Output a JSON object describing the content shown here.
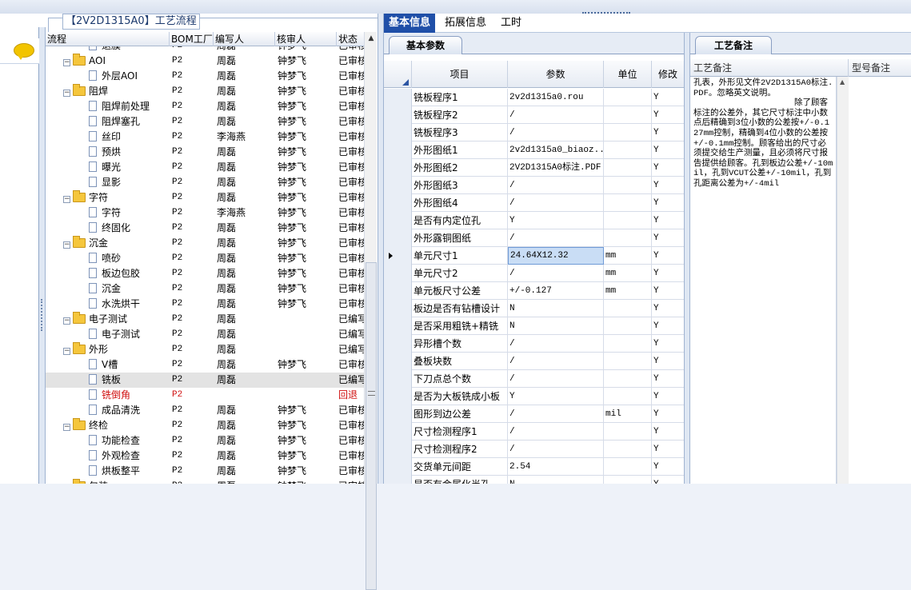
{
  "window": {
    "title": "【2V2D1315A0】工艺流程"
  },
  "tree": {
    "columns": [
      "流程",
      "BOM工厂",
      "编写人",
      "核审人",
      "状态"
    ],
    "rows": [
      {
        "level": 1,
        "type": "doc",
        "name": "退膜",
        "bom": "P2",
        "author": "周磊",
        "reviewer": "钟梦飞",
        "status": "已审核",
        "partial": true
      },
      {
        "level": 0,
        "type": "folder",
        "name": "AOI",
        "bom": "P2",
        "author": "周磊",
        "reviewer": "钟梦飞",
        "status": "已审核"
      },
      {
        "level": 1,
        "type": "doc",
        "name": "外层AOI",
        "bom": "P2",
        "author": "周磊",
        "reviewer": "钟梦飞",
        "status": "已审核"
      },
      {
        "level": 0,
        "type": "folder",
        "name": "阻焊",
        "bom": "P2",
        "author": "周磊",
        "reviewer": "钟梦飞",
        "status": "已审核"
      },
      {
        "level": 1,
        "type": "doc",
        "name": "阻焊前处理",
        "bom": "P2",
        "author": "周磊",
        "reviewer": "钟梦飞",
        "status": "已审核"
      },
      {
        "level": 1,
        "type": "doc",
        "name": "阻焊塞孔",
        "bom": "P2",
        "author": "周磊",
        "reviewer": "钟梦飞",
        "status": "已审核"
      },
      {
        "level": 1,
        "type": "doc",
        "name": "丝印",
        "bom": "P2",
        "author": "李海燕",
        "reviewer": "钟梦飞",
        "status": "已审核"
      },
      {
        "level": 1,
        "type": "doc",
        "name": "预烘",
        "bom": "P2",
        "author": "周磊",
        "reviewer": "钟梦飞",
        "status": "已审核"
      },
      {
        "level": 1,
        "type": "doc",
        "name": "曝光",
        "bom": "P2",
        "author": "周磊",
        "reviewer": "钟梦飞",
        "status": "已审核"
      },
      {
        "level": 1,
        "type": "doc",
        "name": "显影",
        "bom": "P2",
        "author": "周磊",
        "reviewer": "钟梦飞",
        "status": "已审核"
      },
      {
        "level": 0,
        "type": "folder",
        "name": "字符",
        "bom": "P2",
        "author": "周磊",
        "reviewer": "钟梦飞",
        "status": "已审核"
      },
      {
        "level": 1,
        "type": "doc",
        "name": "字符",
        "bom": "P2",
        "author": "李海燕",
        "reviewer": "钟梦飞",
        "status": "已审核"
      },
      {
        "level": 1,
        "type": "doc",
        "name": "终固化",
        "bom": "P2",
        "author": "周磊",
        "reviewer": "钟梦飞",
        "status": "已审核"
      },
      {
        "level": 0,
        "type": "folder",
        "name": "沉金",
        "bom": "P2",
        "author": "周磊",
        "reviewer": "钟梦飞",
        "status": "已审核"
      },
      {
        "level": 1,
        "type": "doc",
        "name": "喷砂",
        "bom": "P2",
        "author": "周磊",
        "reviewer": "钟梦飞",
        "status": "已审核"
      },
      {
        "level": 1,
        "type": "doc",
        "name": "板边包胶",
        "bom": "P2",
        "author": "周磊",
        "reviewer": "钟梦飞",
        "status": "已审核"
      },
      {
        "level": 1,
        "type": "doc",
        "name": "沉金",
        "bom": "P2",
        "author": "周磊",
        "reviewer": "钟梦飞",
        "status": "已审核"
      },
      {
        "level": 1,
        "type": "doc",
        "name": "水洗烘干",
        "bom": "P2",
        "author": "周磊",
        "reviewer": "钟梦飞",
        "status": "已审核"
      },
      {
        "level": 0,
        "type": "folder",
        "name": "电子测试",
        "bom": "P2",
        "author": "周磊",
        "reviewer": "",
        "status": "已编写"
      },
      {
        "level": 1,
        "type": "doc",
        "name": "电子测试",
        "bom": "P2",
        "author": "周磊",
        "reviewer": "",
        "status": "已编写"
      },
      {
        "level": 0,
        "type": "folder",
        "name": "外形",
        "bom": "P2",
        "author": "周磊",
        "reviewer": "",
        "status": "已编写"
      },
      {
        "level": 1,
        "type": "doc",
        "name": "V槽",
        "bom": "P2",
        "author": "周磊",
        "reviewer": "钟梦飞",
        "status": "已审核"
      },
      {
        "level": 1,
        "type": "doc",
        "name": "铣板",
        "bom": "P2",
        "author": "周磊",
        "reviewer": "",
        "status": "已编写",
        "selected": true
      },
      {
        "level": 1,
        "type": "doc",
        "name": "铣倒角",
        "bom": "P2",
        "author": "",
        "reviewer": "",
        "status": "回退",
        "red": true
      },
      {
        "level": 1,
        "type": "doc",
        "name": "成品清洗",
        "bom": "P2",
        "author": "周磊",
        "reviewer": "钟梦飞",
        "status": "已审核"
      },
      {
        "level": 0,
        "type": "folder",
        "name": "终检",
        "bom": "P2",
        "author": "周磊",
        "reviewer": "钟梦飞",
        "status": "已审核"
      },
      {
        "level": 1,
        "type": "doc",
        "name": "功能检查",
        "bom": "P2",
        "author": "周磊",
        "reviewer": "钟梦飞",
        "status": "已审核"
      },
      {
        "level": 1,
        "type": "doc",
        "name": "外观检查",
        "bom": "P2",
        "author": "周磊",
        "reviewer": "钟梦飞",
        "status": "已审核"
      },
      {
        "level": 1,
        "type": "doc",
        "name": "烘板整平",
        "bom": "P2",
        "author": "周磊",
        "reviewer": "钟梦飞",
        "status": "已审核"
      },
      {
        "level": 0,
        "type": "folder",
        "name": "包装",
        "bom": "P2",
        "author": "周磊",
        "reviewer": "钟梦飞",
        "status": "已审核",
        "partial": true
      }
    ]
  },
  "tabs": [
    "基本信息",
    "拓展信息",
    "工时"
  ],
  "subtab": "基本参数",
  "grid": {
    "columns": [
      "项目",
      "参数",
      "单位",
      "修改"
    ],
    "rows": [
      {
        "item": "铣板程序1",
        "param": "2v2d1315a0.rou",
        "unit": "",
        "mod": "Y"
      },
      {
        "item": "铣板程序2",
        "param": "/",
        "unit": "",
        "mod": "Y"
      },
      {
        "item": "铣板程序3",
        "param": "/",
        "unit": "",
        "mod": "Y"
      },
      {
        "item": "外形图纸1",
        "param": "2v2d1315a0_biaoz...",
        "unit": "",
        "mod": "Y"
      },
      {
        "item": "外形图纸2",
        "param": "2V2D1315A0标注.PDF",
        "unit": "",
        "mod": "Y"
      },
      {
        "item": "外形图纸3",
        "param": "/",
        "unit": "",
        "mod": "Y"
      },
      {
        "item": "外形图纸4",
        "param": "/",
        "unit": "",
        "mod": "Y"
      },
      {
        "item": "是否有内定位孔",
        "param": "Y",
        "unit": "",
        "mod": "Y"
      },
      {
        "item": "外形露铜图纸",
        "param": "/",
        "unit": "",
        "mod": "Y"
      },
      {
        "item": "单元尺寸1",
        "param": "24.64X12.32",
        "unit": "mm",
        "mod": "Y",
        "current": true
      },
      {
        "item": "单元尺寸2",
        "param": "/",
        "unit": "mm",
        "mod": "Y"
      },
      {
        "item": "单元板尺寸公差",
        "param": "+/-0.127",
        "unit": "mm",
        "mod": "Y"
      },
      {
        "item": "板边是否有钻槽设计",
        "param": "N",
        "unit": "",
        "mod": "Y"
      },
      {
        "item": "是否采用粗铣+精铣",
        "param": "N",
        "unit": "",
        "mod": "Y"
      },
      {
        "item": "异形槽个数",
        "param": "/",
        "unit": "",
        "mod": "Y"
      },
      {
        "item": "叠板块数",
        "param": "/",
        "unit": "",
        "mod": "Y"
      },
      {
        "item": "下刀点总个数",
        "param": "/",
        "unit": "",
        "mod": "Y"
      },
      {
        "item": "是否为大板铣成小板",
        "param": "Y",
        "unit": "",
        "mod": "Y"
      },
      {
        "item": "图形到边公差",
        "param": "/",
        "unit": "mil",
        "mod": "Y"
      },
      {
        "item": "尺寸检测程序1",
        "param": "/",
        "unit": "",
        "mod": "Y"
      },
      {
        "item": "尺寸检测程序2",
        "param": "/",
        "unit": "",
        "mod": "Y"
      },
      {
        "item": "交货单元间距",
        "param": "2.54",
        "unit": "",
        "mod": "Y"
      },
      {
        "item": "是否有金属化半孔",
        "param": "N",
        "unit": "",
        "mod": "Y",
        "partial": true
      }
    ]
  },
  "notes": {
    "tab": "工艺备注",
    "columns": [
      "工艺备注",
      "型号备注"
    ],
    "text": "孔表，外形见文件2V2D1315A0标注.PDF。忽略英文说明。\n                    除了顾客标注的公差外，其它尺寸标注中小数点后精确到3位小数的公差按+/-0.127mm控制，精确到4位小数的公差按+/-0.1mm控制。顾客给出的尺寸必须提交给生产测量，且必须将尺寸报告提供给顾客。孔到板边公差+/-10mil，孔到VCUT公差+/-10mil，孔到孔距离公差为+/-4mil"
  },
  "colors": {
    "accent": "#1f4fa8",
    "return_status": "#d01010",
    "folder": "#f5c63c"
  },
  "icons": [
    "chat-bubble-icon",
    "folder-icon",
    "document-icon",
    "expand-icon",
    "scroll-up-icon",
    "row-pointer-icon"
  ]
}
